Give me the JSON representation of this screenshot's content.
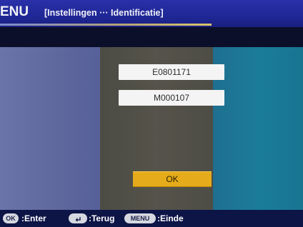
{
  "header": {
    "title": "ENU",
    "breadcrumb": "[Instellingen ··· Identificatie]"
  },
  "fields": [
    {
      "value": "E0801171"
    },
    {
      "value": "M000107"
    }
  ],
  "ok_button": {
    "label": "OK"
  },
  "footer": {
    "ok_key": "OK",
    "ok_action": ":Enter",
    "back_key_icon": "return-arrow-icon",
    "back_action": ":Terug",
    "menu_key": "MENU",
    "menu_action": ":Einde"
  },
  "colors": {
    "header_bg": "#1f2796",
    "panel_left": "#5e689c",
    "panel_center": "#55534a",
    "panel_right": "#1b7c99",
    "ok_button_bg": "#e5ab1a",
    "footer_bg": "#0d1446"
  }
}
